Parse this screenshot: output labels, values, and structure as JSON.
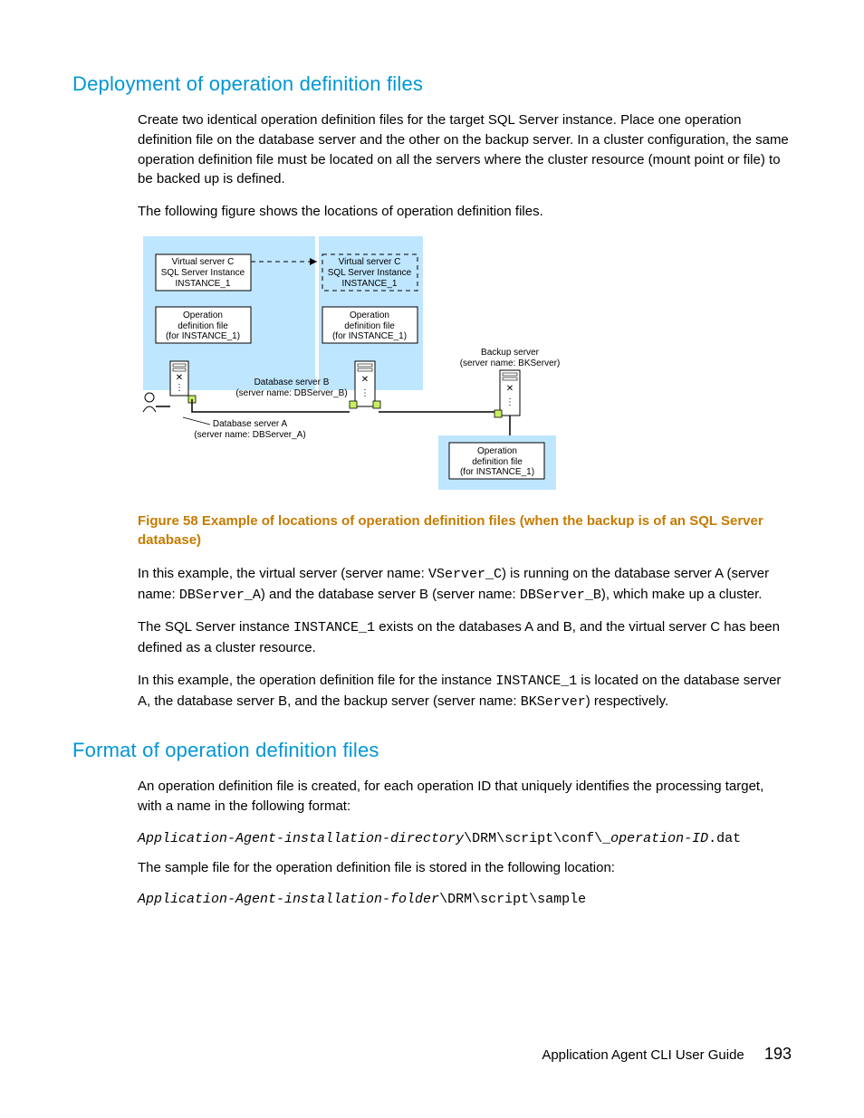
{
  "section1": {
    "heading": "Deployment of operation definition files",
    "para1": "Create two identical operation definition files for the target SQL Server instance. Place one operation definition file on the database server and the other on the backup server. In a cluster configuration, the same operation definition file must be located on all the servers where the cluster resource (mount point or file) to be backed up is defined.",
    "para2": "The following figure shows the locations of operation definition files.",
    "figure_caption": "Figure 58 Example of locations of operation definition files (when the backup is of an SQL Server database)",
    "para3a": "In this example, the virtual server (server name: ",
    "para3b": ") is running on the database server A (server name: ",
    "para3c": ") and the database server B (server name: ",
    "para3d": "), which make up a cluster.",
    "para4a": "The SQL Server instance ",
    "para4b": " exists on the databases A and B, and the virtual server C has been defined as a cluster resource.",
    "para5a": "In this example, the operation definition file for the instance ",
    "para5b": " is located on the database server A, the database server B, and the backup server (server name: ",
    "para5c": ") respectively.",
    "code_vsc": "VServer_C",
    "code_dbsa": "DBServer_A",
    "code_dbsb": "DBServer_B",
    "code_inst": "INSTANCE_1",
    "code_bks": "BKServer"
  },
  "diagram": {
    "vs_c_l1": "Virtual server C",
    "vs_c_l2": "SQL Server Instance",
    "vs_c_l3": "INSTANCE_1",
    "opfile_l1": "Operation",
    "opfile_l2": "definition file",
    "opfile_l3": "(for INSTANCE_1)",
    "dbs_b_l1": "Database server B",
    "dbs_b_l2": "(server name: DBServer_B)",
    "dbs_a_l1": "Database server A",
    "dbs_a_l2": "(server name: DBServer_A)",
    "bks_l1": "Backup server",
    "bks_l2": "(server name: BKServer)"
  },
  "section2": {
    "heading": "Format of operation definition files",
    "para1": "An operation definition file is created, for each operation ID that uniquely identifies the processing target, with a name in the following format:",
    "code1_a": "Application-Agent-installation-directory",
    "code1_b": "\\DRM\\script\\conf\\_",
    "code1_c": "operation-ID",
    "code1_d": ".dat",
    "para2": "The sample file for the operation definition file is stored in the following location:",
    "code2_a": "Application-Agent-installation-folder",
    "code2_b": "\\DRM\\script\\sample"
  },
  "footer": {
    "title": "Application Agent CLI User Guide",
    "page": "193"
  }
}
